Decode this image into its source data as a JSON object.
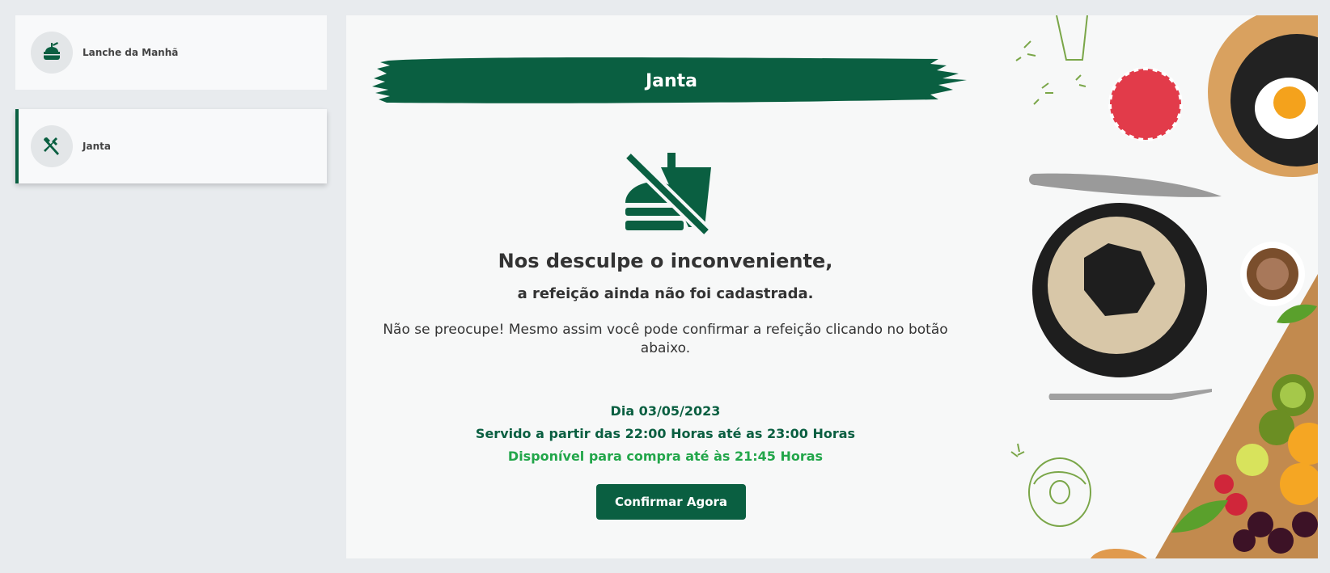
{
  "sidebar": {
    "items": [
      {
        "label": "Lanche da Manhã",
        "icon": "lunchbox-icon"
      },
      {
        "label": "Janta",
        "icon": "fork-knife-icon"
      }
    ]
  },
  "main": {
    "title": "Janta",
    "status_icon": "no-food-icon",
    "heading": "Nos desculpe o inconveniente,",
    "subheading": "a refeição ainda não foi cadastrada.",
    "note": "Não se preocupe! Mesmo assim você pode confirmar a refeição clicando no botão abaixo.",
    "date": "Dia 03/05/2023",
    "served": "Servido a partir das 22:00 Horas até as 23:00 Horas",
    "available": "Disponível para compra até às 21:45 Horas",
    "confirm_button": "Confirmar Agora"
  },
  "colors": {
    "brand_green": "#0a5f41",
    "accent_green": "#22a64a",
    "background": "#e8ebee",
    "panel": "#f7f8f8"
  }
}
